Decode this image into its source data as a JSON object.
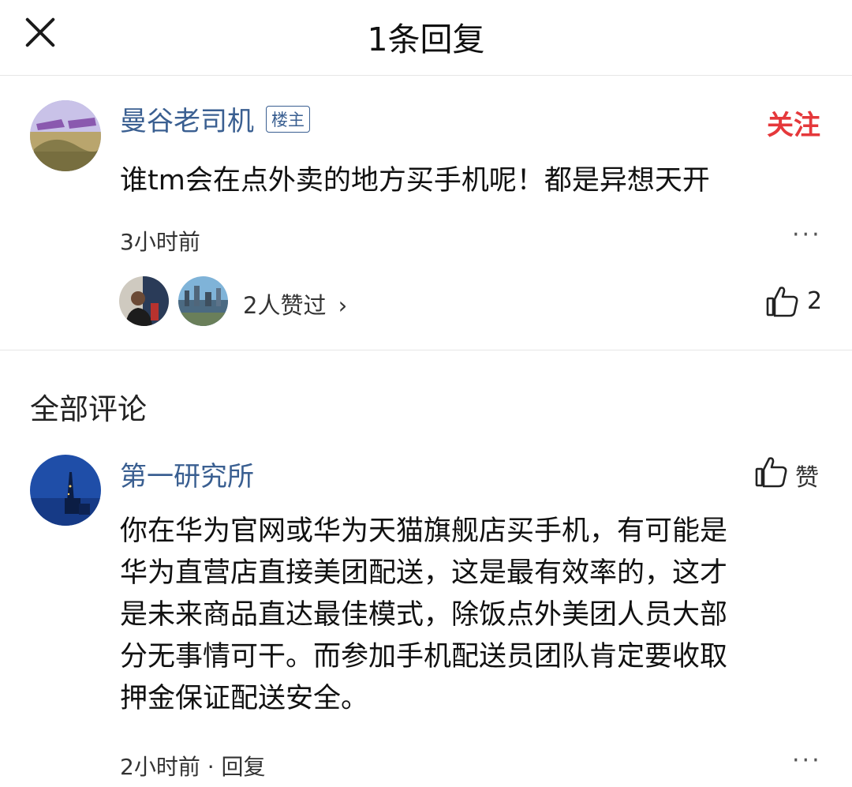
{
  "header": {
    "title": "1条回复",
    "close_icon": "close-icon"
  },
  "main_comment": {
    "username": "曼谷老司机",
    "badge": "楼主",
    "follow_label": "关注",
    "follow_color": "#e5383b",
    "content": "谁tm会在点外卖的地方买手机呢！都是异想天开",
    "time": "3小时前",
    "more_label": "···",
    "likers_label": "2人赞过",
    "likers_chevron": "›",
    "like_count": "2"
  },
  "section": {
    "title": "全部评论"
  },
  "reply": {
    "username": "第一研究所",
    "like_label": "赞",
    "content_lines": [
      "你在华为官网或华为天猫旗舰店买手机，有可能是",
      "华为直营店直接美团配送，这是最有效率的，这才",
      "是未来商品直达最佳模式，除饭点外美团人员大部",
      "分无事情可干。而参加手机配送员团队肯定要收取",
      "押金保证配送安全。"
    ],
    "time": "2小时前 · 回复",
    "more_label": "···"
  },
  "colors": {
    "link": "#3a5f91",
    "accent_red": "#e5383b"
  }
}
